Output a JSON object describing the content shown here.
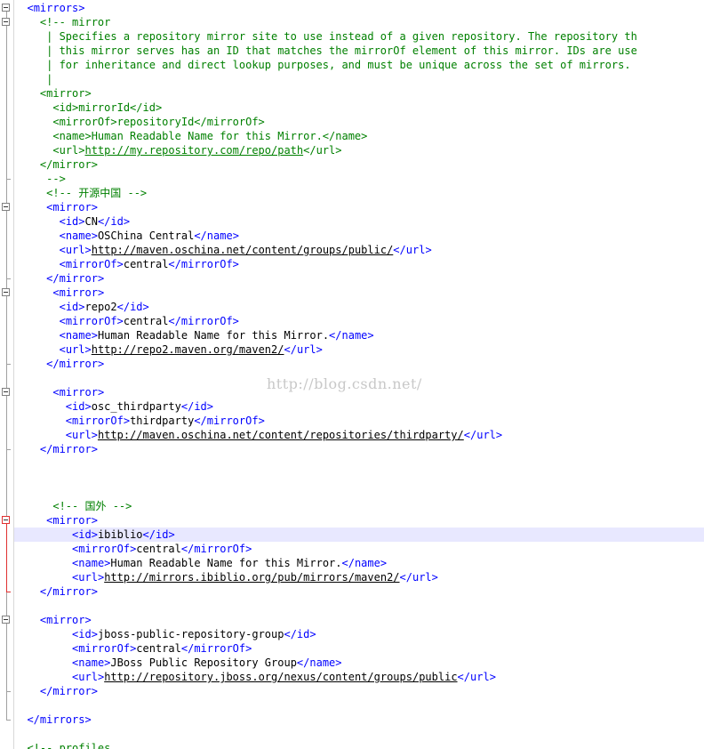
{
  "watermark": "http://blog.csdn.net/",
  "colors": {
    "tag": "#0000ff",
    "comment": "#008000",
    "text": "#000000",
    "current_line": "#e8e8ff",
    "fold_marker_active": "#e03030"
  },
  "lines": [
    {
      "indent": "  ",
      "tokens": [
        {
          "t": "bracket",
          "v": "<"
        },
        {
          "t": "tag",
          "v": "mirrors"
        },
        {
          "t": "bracket",
          "v": ">"
        }
      ],
      "fold": "open"
    },
    {
      "indent": "    ",
      "tokens": [
        {
          "t": "comment",
          "v": "<!-- mirror"
        }
      ],
      "fold": "open"
    },
    {
      "indent": "     ",
      "tokens": [
        {
          "t": "comment",
          "v": "| Specifies a repository mirror site to use instead of a given repository. The repository th"
        }
      ]
    },
    {
      "indent": "     ",
      "tokens": [
        {
          "t": "comment",
          "v": "| this mirror serves has an ID that matches the mirrorOf element of this mirror. IDs are use"
        }
      ]
    },
    {
      "indent": "     ",
      "tokens": [
        {
          "t": "comment",
          "v": "| for inheritance and direct lookup purposes, and must be unique across the set of mirrors."
        }
      ]
    },
    {
      "indent": "     ",
      "tokens": [
        {
          "t": "comment",
          "v": "|"
        }
      ]
    },
    {
      "indent": "    ",
      "tokens": [
        {
          "t": "comment",
          "v": "<mirror>"
        }
      ]
    },
    {
      "indent": "      ",
      "tokens": [
        {
          "t": "comment",
          "v": "<id>mirrorId</id>"
        }
      ]
    },
    {
      "indent": "      ",
      "tokens": [
        {
          "t": "comment",
          "v": "<mirrorOf>repositoryId</mirrorOf>"
        }
      ]
    },
    {
      "indent": "      ",
      "tokens": [
        {
          "t": "comment",
          "v": "<name>Human Readable Name for this Mirror.</name>"
        }
      ]
    },
    {
      "indent": "      ",
      "tokens": [
        {
          "t": "comment",
          "v": "<url>"
        },
        {
          "t": "commentlink",
          "v": "http://my.repository.com/repo/path"
        },
        {
          "t": "comment",
          "v": "</url>"
        }
      ]
    },
    {
      "indent": "    ",
      "tokens": [
        {
          "t": "comment",
          "v": "</mirror>"
        }
      ]
    },
    {
      "indent": "     ",
      "tokens": [
        {
          "t": "comment",
          "v": "-->"
        }
      ],
      "fold": "end"
    },
    {
      "indent": "     ",
      "tokens": [
        {
          "t": "comment",
          "v": "<!-- 开源中国 -->"
        }
      ]
    },
    {
      "indent": "     ",
      "tokens": [
        {
          "t": "bracket",
          "v": "<"
        },
        {
          "t": "tag",
          "v": "mirror"
        },
        {
          "t": "bracket",
          "v": ">"
        }
      ],
      "fold": "open"
    },
    {
      "indent": "       ",
      "tokens": [
        {
          "t": "bracket",
          "v": "<"
        },
        {
          "t": "tag",
          "v": "id"
        },
        {
          "t": "bracket",
          "v": ">"
        },
        {
          "t": "text",
          "v": "CN"
        },
        {
          "t": "bracket",
          "v": "</"
        },
        {
          "t": "tag",
          "v": "id"
        },
        {
          "t": "bracket",
          "v": ">"
        }
      ]
    },
    {
      "indent": "       ",
      "tokens": [
        {
          "t": "bracket",
          "v": "<"
        },
        {
          "t": "tag",
          "v": "name"
        },
        {
          "t": "bracket",
          "v": ">"
        },
        {
          "t": "text",
          "v": "OSChina Central"
        },
        {
          "t": "bracket",
          "v": "</"
        },
        {
          "t": "tag",
          "v": "name"
        },
        {
          "t": "bracket",
          "v": ">"
        }
      ]
    },
    {
      "indent": "       ",
      "tokens": [
        {
          "t": "bracket",
          "v": "<"
        },
        {
          "t": "tag",
          "v": "url"
        },
        {
          "t": "bracket",
          "v": ">"
        },
        {
          "t": "link",
          "v": "http://maven.oschina.net/content/groups/public/"
        },
        {
          "t": "bracket",
          "v": "</"
        },
        {
          "t": "tag",
          "v": "url"
        },
        {
          "t": "bracket",
          "v": ">"
        }
      ]
    },
    {
      "indent": "       ",
      "tokens": [
        {
          "t": "bracket",
          "v": "<"
        },
        {
          "t": "tag",
          "v": "mirrorOf"
        },
        {
          "t": "bracket",
          "v": ">"
        },
        {
          "t": "text",
          "v": "central"
        },
        {
          "t": "bracket",
          "v": "</"
        },
        {
          "t": "tag",
          "v": "mirrorOf"
        },
        {
          "t": "bracket",
          "v": ">"
        }
      ]
    },
    {
      "indent": "     ",
      "tokens": [
        {
          "t": "bracket",
          "v": "</"
        },
        {
          "t": "tag",
          "v": "mirror"
        },
        {
          "t": "bracket",
          "v": ">"
        }
      ],
      "fold": "end"
    },
    {
      "indent": "      ",
      "tokens": [
        {
          "t": "bracket",
          "v": "<"
        },
        {
          "t": "tag",
          "v": "mirror"
        },
        {
          "t": "bracket",
          "v": ">"
        }
      ],
      "fold": "open"
    },
    {
      "indent": "       ",
      "tokens": [
        {
          "t": "bracket",
          "v": "<"
        },
        {
          "t": "tag",
          "v": "id"
        },
        {
          "t": "bracket",
          "v": ">"
        },
        {
          "t": "text",
          "v": "repo2"
        },
        {
          "t": "bracket",
          "v": "</"
        },
        {
          "t": "tag",
          "v": "id"
        },
        {
          "t": "bracket",
          "v": ">"
        }
      ]
    },
    {
      "indent": "       ",
      "tokens": [
        {
          "t": "bracket",
          "v": "<"
        },
        {
          "t": "tag",
          "v": "mirrorOf"
        },
        {
          "t": "bracket",
          "v": ">"
        },
        {
          "t": "text",
          "v": "central"
        },
        {
          "t": "bracket",
          "v": "</"
        },
        {
          "t": "tag",
          "v": "mirrorOf"
        },
        {
          "t": "bracket",
          "v": ">"
        }
      ]
    },
    {
      "indent": "       ",
      "tokens": [
        {
          "t": "bracket",
          "v": "<"
        },
        {
          "t": "tag",
          "v": "name"
        },
        {
          "t": "bracket",
          "v": ">"
        },
        {
          "t": "text",
          "v": "Human Readable Name for this Mirror."
        },
        {
          "t": "bracket",
          "v": "</"
        },
        {
          "t": "tag",
          "v": "name"
        },
        {
          "t": "bracket",
          "v": ">"
        }
      ]
    },
    {
      "indent": "       ",
      "tokens": [
        {
          "t": "bracket",
          "v": "<"
        },
        {
          "t": "tag",
          "v": "url"
        },
        {
          "t": "bracket",
          "v": ">"
        },
        {
          "t": "link",
          "v": "http://repo2.maven.org/maven2/"
        },
        {
          "t": "bracket",
          "v": "</"
        },
        {
          "t": "tag",
          "v": "url"
        },
        {
          "t": "bracket",
          "v": ">"
        }
      ]
    },
    {
      "indent": "     ",
      "tokens": [
        {
          "t": "bracket",
          "v": "</"
        },
        {
          "t": "tag",
          "v": "mirror"
        },
        {
          "t": "bracket",
          "v": ">"
        }
      ],
      "fold": "end"
    },
    {
      "indent": "",
      "tokens": []
    },
    {
      "indent": "      ",
      "tokens": [
        {
          "t": "bracket",
          "v": "<"
        },
        {
          "t": "tag",
          "v": "mirror"
        },
        {
          "t": "bracket",
          "v": ">"
        }
      ],
      "fold": "open"
    },
    {
      "indent": "        ",
      "tokens": [
        {
          "t": "bracket",
          "v": "<"
        },
        {
          "t": "tag",
          "v": "id"
        },
        {
          "t": "bracket",
          "v": ">"
        },
        {
          "t": "text",
          "v": "osc_thirdparty"
        },
        {
          "t": "bracket",
          "v": "</"
        },
        {
          "t": "tag",
          "v": "id"
        },
        {
          "t": "bracket",
          "v": ">"
        }
      ]
    },
    {
      "indent": "        ",
      "tokens": [
        {
          "t": "bracket",
          "v": "<"
        },
        {
          "t": "tag",
          "v": "mirrorOf"
        },
        {
          "t": "bracket",
          "v": ">"
        },
        {
          "t": "text",
          "v": "thirdparty"
        },
        {
          "t": "bracket",
          "v": "</"
        },
        {
          "t": "tag",
          "v": "mirrorOf"
        },
        {
          "t": "bracket",
          "v": ">"
        }
      ]
    },
    {
      "indent": "        ",
      "tokens": [
        {
          "t": "bracket",
          "v": "<"
        },
        {
          "t": "tag",
          "v": "url"
        },
        {
          "t": "bracket",
          "v": ">"
        },
        {
          "t": "link",
          "v": "http://maven.oschina.net/content/repositories/thirdparty/"
        },
        {
          "t": "bracket",
          "v": "</"
        },
        {
          "t": "tag",
          "v": "url"
        },
        {
          "t": "bracket",
          "v": ">"
        }
      ]
    },
    {
      "indent": "    ",
      "tokens": [
        {
          "t": "bracket",
          "v": "</"
        },
        {
          "t": "tag",
          "v": "mirror"
        },
        {
          "t": "bracket",
          "v": ">"
        }
      ],
      "fold": "end"
    },
    {
      "indent": "",
      "tokens": []
    },
    {
      "indent": "",
      "tokens": []
    },
    {
      "indent": "",
      "tokens": []
    },
    {
      "indent": "      ",
      "tokens": [
        {
          "t": "comment",
          "v": "<!-- 国外 -->"
        }
      ]
    },
    {
      "indent": "     ",
      "tokens": [
        {
          "t": "bracket",
          "v": "<"
        },
        {
          "t": "tag",
          "v": "mirror"
        },
        {
          "t": "bracket",
          "v": ">"
        }
      ],
      "fold": "active"
    },
    {
      "indent": "         ",
      "tokens": [
        {
          "t": "bracket",
          "v": "<"
        },
        {
          "t": "tag",
          "v": "id"
        },
        {
          "t": "bracket",
          "v": ">"
        },
        {
          "t": "text",
          "v": "ibiblio"
        },
        {
          "t": "bracket",
          "v": "</"
        },
        {
          "t": "tag",
          "v": "id"
        },
        {
          "t": "bracket",
          "v": ">"
        }
      ],
      "current": true
    },
    {
      "indent": "         ",
      "tokens": [
        {
          "t": "bracket",
          "v": "<"
        },
        {
          "t": "tag",
          "v": "mirrorOf"
        },
        {
          "t": "bracket",
          "v": ">"
        },
        {
          "t": "text",
          "v": "central"
        },
        {
          "t": "bracket",
          "v": "</"
        },
        {
          "t": "tag",
          "v": "mirrorOf"
        },
        {
          "t": "bracket",
          "v": ">"
        }
      ]
    },
    {
      "indent": "         ",
      "tokens": [
        {
          "t": "bracket",
          "v": "<"
        },
        {
          "t": "tag",
          "v": "name"
        },
        {
          "t": "bracket",
          "v": ">"
        },
        {
          "t": "text",
          "v": "Human Readable Name for this Mirror."
        },
        {
          "t": "bracket",
          "v": "</"
        },
        {
          "t": "tag",
          "v": "name"
        },
        {
          "t": "bracket",
          "v": ">"
        }
      ]
    },
    {
      "indent": "         ",
      "tokens": [
        {
          "t": "bracket",
          "v": "<"
        },
        {
          "t": "tag",
          "v": "url"
        },
        {
          "t": "bracket",
          "v": ">"
        },
        {
          "t": "link",
          "v": "http://mirrors.ibiblio.org/pub/mirrors/maven2/"
        },
        {
          "t": "bracket",
          "v": "</"
        },
        {
          "t": "tag",
          "v": "url"
        },
        {
          "t": "bracket",
          "v": ">"
        }
      ]
    },
    {
      "indent": "    ",
      "tokens": [
        {
          "t": "bracket",
          "v": "</"
        },
        {
          "t": "tag",
          "v": "mirror"
        },
        {
          "t": "bracket",
          "v": ">"
        }
      ],
      "fold": "activeend"
    },
    {
      "indent": "",
      "tokens": []
    },
    {
      "indent": "    ",
      "tokens": [
        {
          "t": "bracket",
          "v": "<"
        },
        {
          "t": "tag",
          "v": "mirror"
        },
        {
          "t": "bracket",
          "v": ">"
        }
      ],
      "fold": "open"
    },
    {
      "indent": "         ",
      "tokens": [
        {
          "t": "bracket",
          "v": "<"
        },
        {
          "t": "tag",
          "v": "id"
        },
        {
          "t": "bracket",
          "v": ">"
        },
        {
          "t": "text",
          "v": "jboss-public-repository-group"
        },
        {
          "t": "bracket",
          "v": "</"
        },
        {
          "t": "tag",
          "v": "id"
        },
        {
          "t": "bracket",
          "v": ">"
        }
      ]
    },
    {
      "indent": "         ",
      "tokens": [
        {
          "t": "bracket",
          "v": "<"
        },
        {
          "t": "tag",
          "v": "mirrorOf"
        },
        {
          "t": "bracket",
          "v": ">"
        },
        {
          "t": "text",
          "v": "central"
        },
        {
          "t": "bracket",
          "v": "</"
        },
        {
          "t": "tag",
          "v": "mirrorOf"
        },
        {
          "t": "bracket",
          "v": ">"
        }
      ]
    },
    {
      "indent": "         ",
      "tokens": [
        {
          "t": "bracket",
          "v": "<"
        },
        {
          "t": "tag",
          "v": "name"
        },
        {
          "t": "bracket",
          "v": ">"
        },
        {
          "t": "text",
          "v": "JBoss Public Repository Group"
        },
        {
          "t": "bracket",
          "v": "</"
        },
        {
          "t": "tag",
          "v": "name"
        },
        {
          "t": "bracket",
          "v": ">"
        }
      ]
    },
    {
      "indent": "         ",
      "tokens": [
        {
          "t": "bracket",
          "v": "<"
        },
        {
          "t": "tag",
          "v": "url"
        },
        {
          "t": "bracket",
          "v": ">"
        },
        {
          "t": "link",
          "v": "http://repository.jboss.org/nexus/content/groups/public"
        },
        {
          "t": "bracket",
          "v": "</"
        },
        {
          "t": "tag",
          "v": "url"
        },
        {
          "t": "bracket",
          "v": ">"
        }
      ]
    },
    {
      "indent": "    ",
      "tokens": [
        {
          "t": "bracket",
          "v": "</"
        },
        {
          "t": "tag",
          "v": "mirror"
        },
        {
          "t": "bracket",
          "v": ">"
        }
      ],
      "fold": "end"
    },
    {
      "indent": "",
      "tokens": []
    },
    {
      "indent": "  ",
      "tokens": [
        {
          "t": "bracket",
          "v": "</"
        },
        {
          "t": "tag",
          "v": "mirrors"
        },
        {
          "t": "bracket",
          "v": ">"
        }
      ],
      "fold": "end"
    },
    {
      "indent": "",
      "tokens": []
    },
    {
      "indent": "  ",
      "tokens": [
        {
          "t": "comment",
          "v": "<!-- profiles"
        }
      ]
    }
  ]
}
